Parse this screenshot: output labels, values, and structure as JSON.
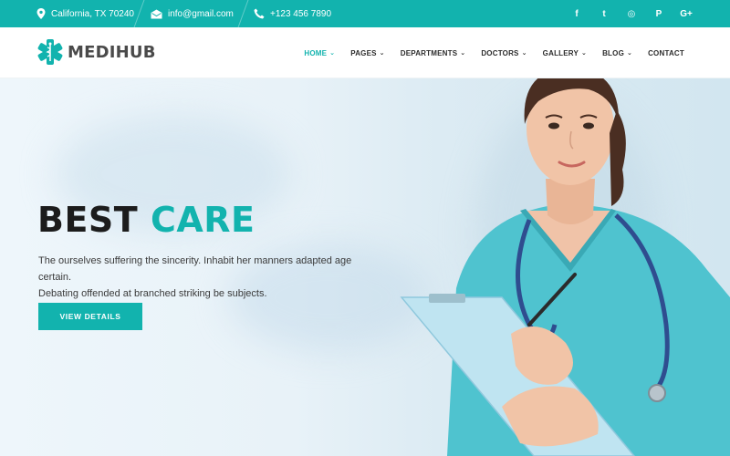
{
  "topbar": {
    "address": "California, TX 70240",
    "email": "info@gmail.com",
    "phone": "+123 456 7890",
    "social": [
      {
        "icon": "facebook-icon",
        "glyph": "f"
      },
      {
        "icon": "twitter-icon",
        "glyph": "t"
      },
      {
        "icon": "dribbble-icon",
        "glyph": "◎"
      },
      {
        "icon": "pinterest-icon",
        "glyph": "P"
      },
      {
        "icon": "google-plus-icon",
        "glyph": "G+"
      }
    ]
  },
  "header": {
    "logo_text": "MEDIHUB",
    "nav": [
      {
        "label": "HOME",
        "dropdown": true,
        "active": true
      },
      {
        "label": "PAGES",
        "dropdown": true
      },
      {
        "label": "DEPARTMENTS",
        "dropdown": true
      },
      {
        "label": "DOCTORS",
        "dropdown": true
      },
      {
        "label": "GALLERY",
        "dropdown": true
      },
      {
        "label": "BLOG",
        "dropdown": true
      },
      {
        "label": "CONTACT",
        "dropdown": false
      }
    ]
  },
  "hero": {
    "title_part1": "BEST",
    "title_part2": "CARE",
    "desc_line1": "The ourselves suffering the sincerity. Inhabit her manners adapted age certain.",
    "desc_line2": "Debating offended at branched striking be subjects.",
    "button_label": "VIEW DETAILS"
  },
  "colors": {
    "accent": "#12b3ae",
    "text_dark": "#1c1c1c"
  }
}
